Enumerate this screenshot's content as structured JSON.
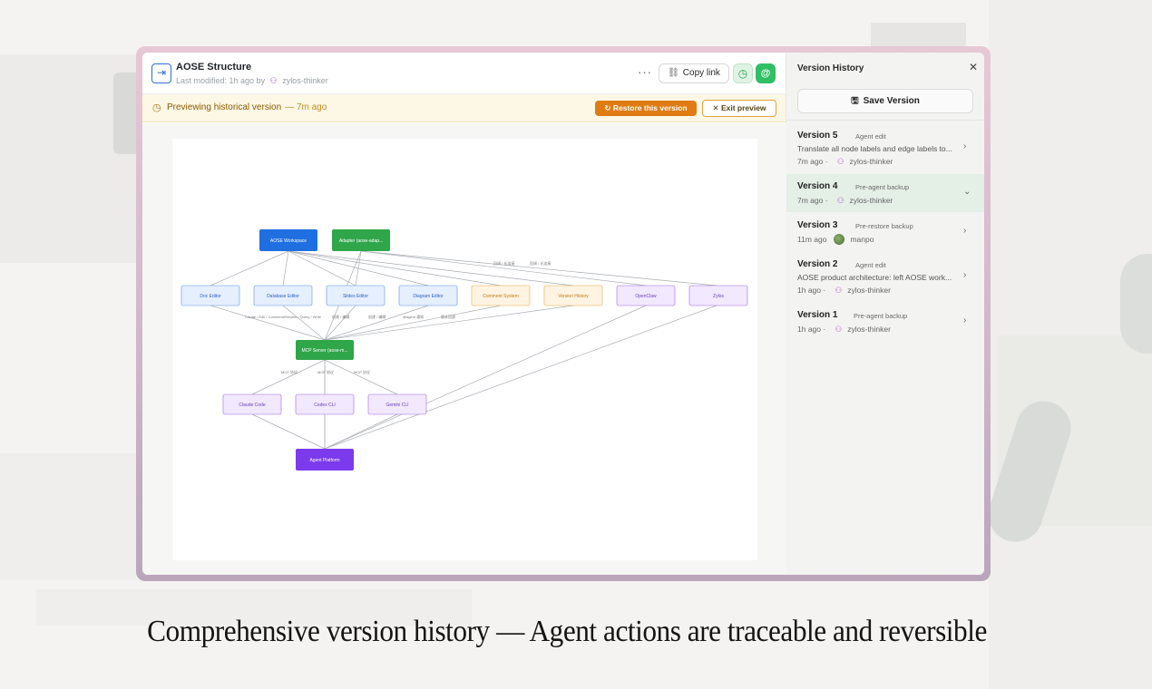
{
  "header": {
    "title": "AOSE Structure",
    "meta_prefix": "Last modified: 1h ago by",
    "meta_user": "zylos-thinker",
    "more_label": "···",
    "copy_link_label": "Copy link",
    "at_label": "@"
  },
  "banner": {
    "text": "Previewing historical version",
    "time": "— 7m ago",
    "restore_label": "Restore this version",
    "exit_label": "Exit preview"
  },
  "diagram": {
    "nodes": {
      "workspace": "AOSE Workspace",
      "adapter": "Adapter (aose-adap...",
      "doc": "Doc Editor",
      "database": "Database Editor",
      "slides": "Slides Editor",
      "diagram": "Diagram Editor",
      "comment": "Comment System",
      "version": "Version History",
      "openclaw": "OpenClaw",
      "zylos": "Zylos",
      "mcp": "MCP Server (aose-m...",
      "claude": "Claude Code",
      "codex": "Codex CLI",
      "gemini": "Gemini CLI",
      "platform": "Agent Platform"
    },
    "edge_labels": {
      "crud": "Create / Edit / Comment/Review / Query / Write",
      "create_edit_1": "创建 / 编辑",
      "create_edit_2": "创建 / 编辑",
      "mention": "@agent 通知",
      "history": "版本回滚",
      "mcp1": "MCP 协议",
      "mcp2": "MCP 协议",
      "mcp3": "MCP 协议",
      "top1": "回调 / 长连接",
      "top2": "回调 / 长连接"
    }
  },
  "sidebar": {
    "title": "Version History",
    "close_label": "✕",
    "save_label": "Save Version",
    "versions": [
      {
        "title": "Version 5",
        "tag": "Agent edit",
        "desc": "Translate all node labels and edge labels to...",
        "time": "7m ago",
        "user": "zylos-thinker"
      },
      {
        "title": "Version 4",
        "tag": "Pre-agent backup",
        "desc": "",
        "time": "7m ago",
        "user": "zylos-thinker"
      },
      {
        "title": "Version 3",
        "tag": "Pre-restore backup",
        "desc": "",
        "time": "11m ago",
        "user": "manpo"
      },
      {
        "title": "Version 2",
        "tag": "Agent edit",
        "desc": "AOSE product architecture: left AOSE work...",
        "time": "1h ago",
        "user": "zylos-thinker"
      },
      {
        "title": "Version 1",
        "tag": "Pre-agent backup",
        "desc": "",
        "time": "1h ago",
        "user": "zylos-thinker"
      }
    ]
  },
  "caption": "Comprehensive version history — Agent actions are traceable and reversible",
  "colors": {
    "blue_node": "#1f6fe0",
    "green_node": "#2fa64a",
    "purple_node": "#7c3aed",
    "restore": "#e07b12",
    "active_version": "#e4efe6"
  }
}
